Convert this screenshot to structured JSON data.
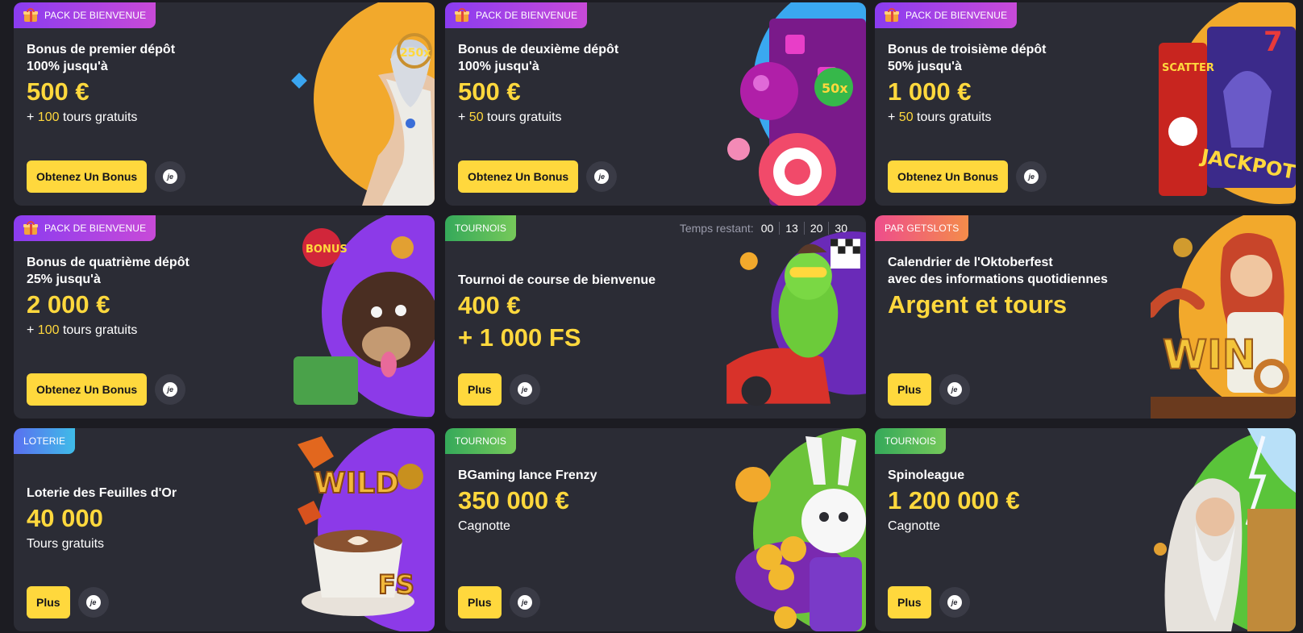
{
  "cards": [
    {
      "badge": "PACK DE BIENVENUE",
      "title_line1": "Bonus de premier dépôt",
      "title_line2": "100% jusqu'à",
      "amount": "500 €",
      "sub_prefix": "+ ",
      "sub_highlight": "100",
      "sub_suffix": " tours gratuits",
      "button": "Obtenez Un Bonus",
      "circle_text": "je"
    },
    {
      "badge": "PACK DE BIENVENUE",
      "title_line1": "Bonus de deuxième dépôt",
      "title_line2": "100% jusqu'à",
      "amount": "500 €",
      "sub_prefix": "+ ",
      "sub_highlight": "50",
      "sub_suffix": " tours gratuits",
      "button": "Obtenez Un Bonus",
      "circle_text": "je"
    },
    {
      "badge": "PACK DE BIENVENUE",
      "title_line1": "Bonus de troisième dépôt",
      "title_line2": "50% jusqu'à",
      "amount": "1 000 €",
      "sub_prefix": "+ ",
      "sub_highlight": "50",
      "sub_suffix": " tours gratuits",
      "button": "Obtenez Un Bonus",
      "circle_text": "je"
    },
    {
      "badge": "PACK DE BIENVENUE",
      "title_line1": "Bonus de quatrième dépôt",
      "title_line2": "25% jusqu'à",
      "amount": "2 000 €",
      "sub_prefix": "+ ",
      "sub_highlight": "100",
      "sub_suffix": " tours gratuits",
      "button": "Obtenez Un Bonus",
      "circle_text": "je"
    },
    {
      "badge": "TOURNOIS",
      "timer_label": "Temps restant:",
      "timer": [
        "00",
        "13",
        "20",
        "30"
      ],
      "title_line1": "Tournoi de course de bienvenue",
      "amount": "400 €",
      "amount2": "+ 1 000 FS",
      "button": "Plus",
      "circle_text": "je"
    },
    {
      "badge": "PAR GETSLOTS",
      "title_line1": "Calendrier de l'Oktoberfest",
      "title_line2": "avec des informations quotidiennes",
      "amount": "Argent et tours",
      "button": "Plus",
      "circle_text": "je"
    },
    {
      "badge": "LOTERIE",
      "title_line1": "Loterie des Feuilles d'Or",
      "amount": "40 000",
      "sub": "Tours gratuits",
      "button": "Plus",
      "circle_text": "je"
    },
    {
      "badge": "TOURNOIS",
      "title_line1": "BGaming lance Frenzy",
      "amount": "350 000 €",
      "sub": "Cagnotte",
      "button": "Plus",
      "circle_text": "je"
    },
    {
      "badge": "TOURNOIS",
      "title_line1": "Spinoleague",
      "amount": "1 200 000 €",
      "sub": "Cagnotte",
      "button": "Plus",
      "circle_text": "je"
    }
  ],
  "colors": {
    "accent": "#ffd83d",
    "card_bg": "#2b2c35",
    "page_bg": "#1c1c22"
  },
  "icons": [
    "gift-icon",
    "je-icon"
  ]
}
